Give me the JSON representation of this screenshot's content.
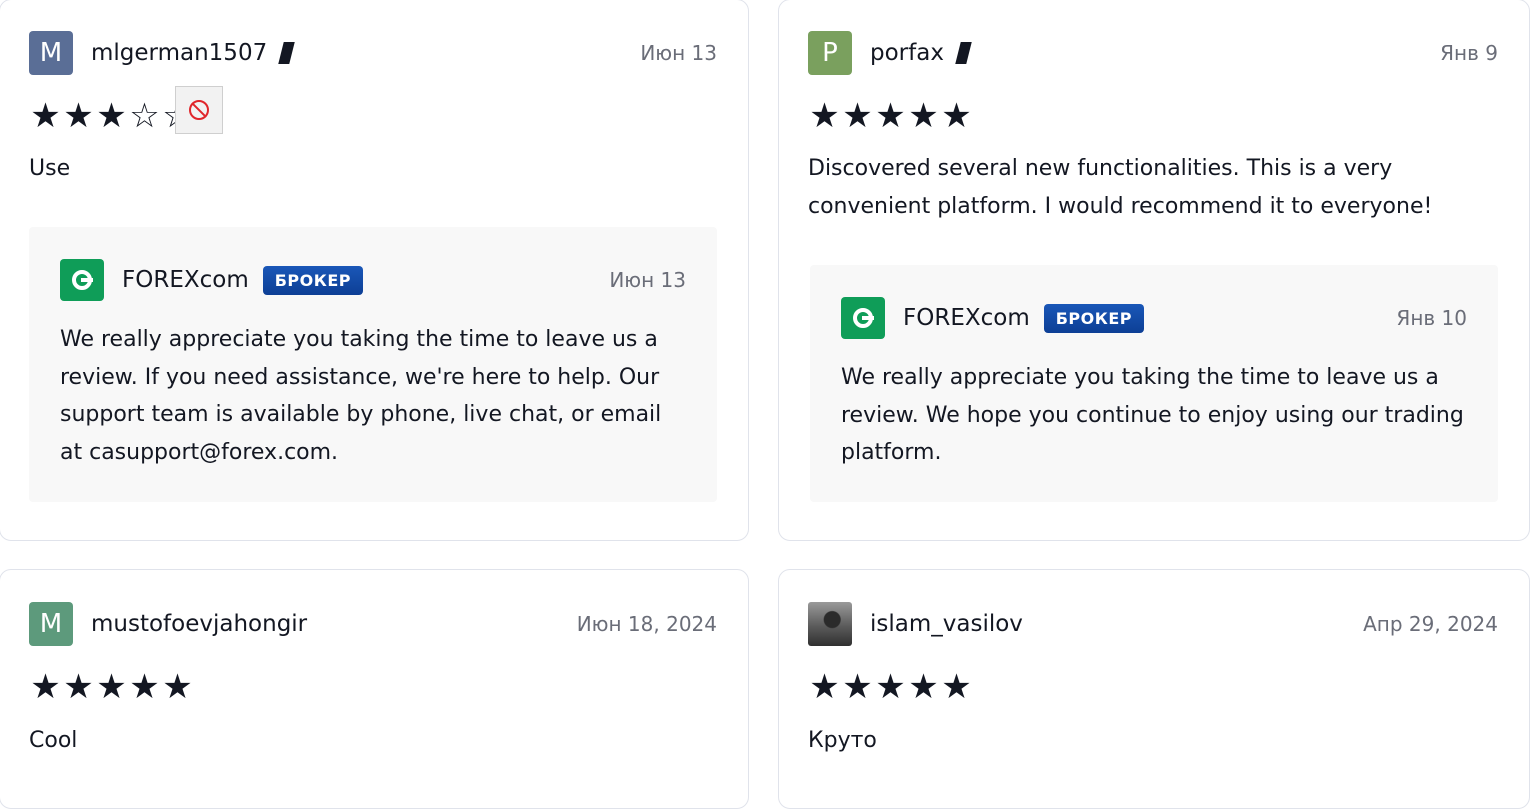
{
  "reviews": [
    {
      "avatar_letter": "M",
      "avatar_color": "#5a6e96",
      "username": "mlgerman1507",
      "date": "Июн 13",
      "rating": 3,
      "text": "Use",
      "reply": {
        "broker": "FOREXcom",
        "badge": "БРОКЕР",
        "date": "Июн 13",
        "text": "We really appreciate you taking the time to leave us a review. If you need assistance, we're here to help. Our support team is available by phone, live chat, or email at casupport@forex.com."
      }
    },
    {
      "avatar_letter": "P",
      "avatar_color": "#7aa05e",
      "username": "porfax",
      "date": "Янв 9",
      "rating": 5,
      "text": "Discovered several new functionalities. This is a very convenient platform. I would recommend it to everyone!",
      "reply": {
        "broker": "FOREXcom",
        "badge": "БРОКЕР",
        "date": "Янв 10",
        "text": "We really appreciate you taking the time to leave us a review. We hope you continue to enjoy using our trading platform."
      }
    },
    {
      "avatar_letter": "M",
      "avatar_color": "#5d9a7c",
      "username": "mustofoevjahongir",
      "date": "Июн 18, 2024",
      "rating": 5,
      "text": "Cool"
    },
    {
      "avatar_letter": "",
      "avatar_color": "#555555",
      "username": "islam_vasilov",
      "date": "Апр 29, 2024",
      "rating": 5,
      "text": "Круто"
    }
  ],
  "icons": {
    "edit": "pencil-icon",
    "block": "no-entry-icon",
    "star_full": "★",
    "star_empty": "☆"
  }
}
